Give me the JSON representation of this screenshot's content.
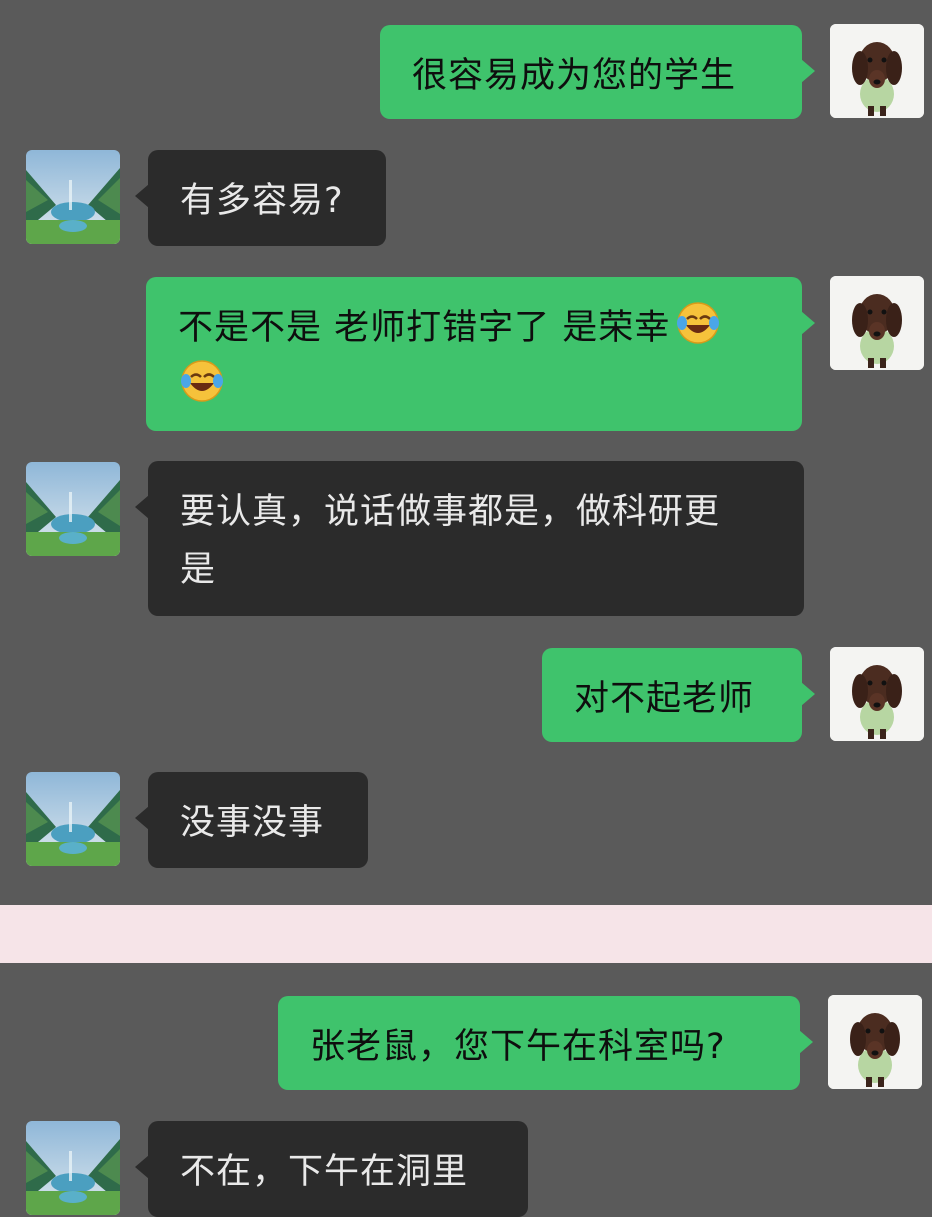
{
  "messages": [
    {
      "side": "me",
      "text": "很容易成为您的学生"
    },
    {
      "side": "them",
      "text": "有多容易?"
    },
    {
      "side": "me",
      "text_line1": "不是不是 老师打错字了 是荣幸",
      "emoji1": "laughing-crying-emoji",
      "emoji2": "laughing-crying-emoji"
    },
    {
      "side": "them",
      "text_line1": "要认真，说话做事都是，做科研更",
      "text_line2": "是"
    },
    {
      "side": "me",
      "text": "对不起老师"
    },
    {
      "side": "them",
      "text": "没事没事"
    },
    {
      "side": "me",
      "text": "张老鼠，您下午在科室吗?"
    },
    {
      "side": "them",
      "text": "不在，下午在洞里"
    }
  ],
  "avatars": {
    "me": "dachshund-puppy-avatar",
    "them": "mountain-lake-landscape-avatar"
  },
  "colors": {
    "background": "#5a5a5a",
    "my_bubble": "#3fc36c",
    "their_bubble": "#2b2b2b",
    "divider": "#f6e4e8"
  }
}
